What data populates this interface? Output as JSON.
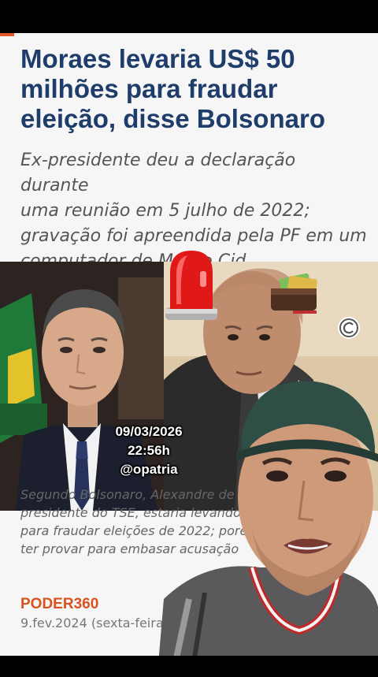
{
  "article": {
    "headline": [
      "Moraes levaria US$ 50",
      "milhões para fraudar",
      "eleição, disse Bolsonaro"
    ],
    "subheadline": [
      "Ex-presidente deu a declaração durante",
      "uma reunião em 5 julho de 2022;",
      "gravação foi apreendida pela PF em um",
      "computador de Mauro Cid"
    ],
    "caption": [
      "Segundo Bolsonaro, Alexandre de",
      "presidente do TSE, estaria levando",
      "para fraudar eleições de 2022; pore",
      "ter provar para embasar acusação"
    ],
    "brand": "PODER360",
    "date": "9.fev.2024 (sexta-feira"
  },
  "overlay": {
    "date": "09/03/2026",
    "time": "22:56h",
    "handle": "@opatria"
  },
  "icons": {
    "siren": "siren-icon",
    "money": "money-icon",
    "copyright": "copyright-icon"
  },
  "colors": {
    "headline": "#1e3d6b",
    "brand": "#d9531e",
    "siren": "#e01818"
  }
}
